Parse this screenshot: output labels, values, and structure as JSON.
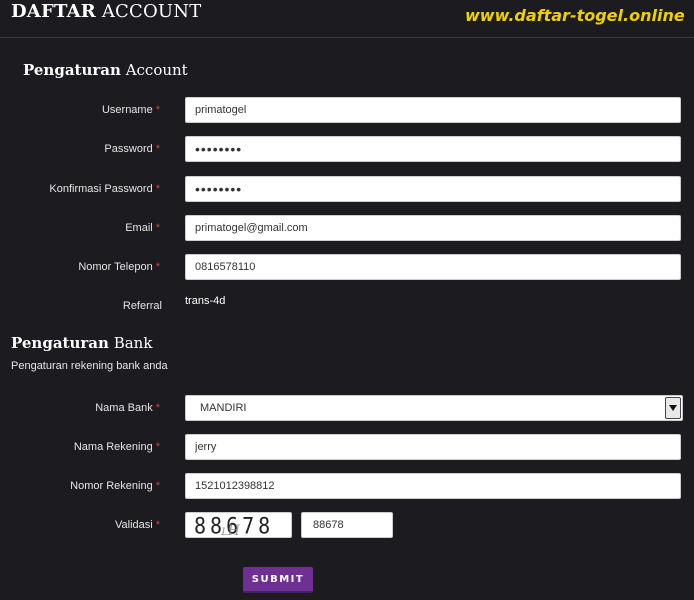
{
  "header": {
    "title_bold": "DAFTAR",
    "title_light": "ACCOUNT",
    "watermark": "www.daftar-togel.online"
  },
  "account": {
    "section_bold": "Pengaturan",
    "section_light": "Account",
    "required_mark": "*",
    "fields": {
      "username": {
        "label": "Username",
        "value": "primatogel"
      },
      "password": {
        "label": "Password",
        "value": "••••••••"
      },
      "confirm_password": {
        "label": "Konfirmasi Password",
        "value": "••••••••"
      },
      "email": {
        "label": "Email",
        "value": "primatogel@gmail.com"
      },
      "phone": {
        "label": "Nomor Telepon",
        "value": "0816578110"
      },
      "referral": {
        "label": "Referral",
        "value": "trans-4d"
      }
    }
  },
  "bank": {
    "section_bold": "Pengaturan",
    "section_light": "Bank",
    "subtitle": "Pengaturan rekening bank anda",
    "fields": {
      "bank_name": {
        "label": "Nama Bank",
        "value": "MANDIRI"
      },
      "account_name": {
        "label": "Nama Rekening",
        "value": "jerry"
      },
      "account_number": {
        "label": "Nomor Rekening",
        "value": "1521012398812"
      },
      "validation": {
        "label": "Validasi",
        "captcha": "88678",
        "value": "88678"
      }
    }
  },
  "submit_label": "SUBMIT",
  "colors": {
    "background": "#1c1b1f",
    "accent": "#6f2f95",
    "required": "#e0383c",
    "watermark": "#f0d000"
  }
}
